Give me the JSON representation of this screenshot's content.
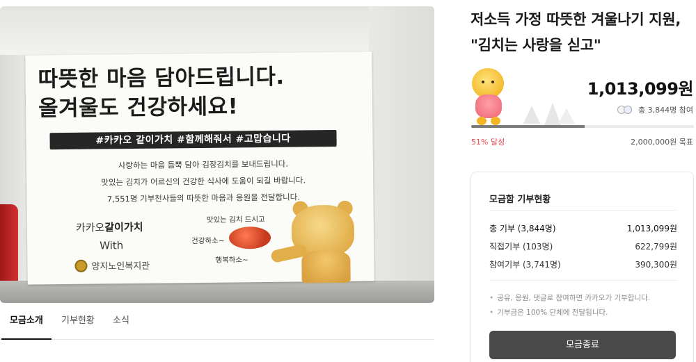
{
  "photo": {
    "sign_title": "따뜻한 마음 담아드립니다.\n올겨울도 건강하세요!",
    "sign_tags": "#카카오 같이가치  #함께해줘서  #고맙습니다",
    "sign_lines": [
      "사랑하는 마음 듬뿍 담아 김장김치를 보내드립니다.",
      "맛있는 김치가 어르신의 건강한 식사에 도움이 되길 바랍니다.",
      "7,551명 기부천사들의 따뜻한 마음과 응원을 전달합니다."
    ],
    "brand_prefix": "카카오",
    "brand_bold": "같이가치",
    "with": "With",
    "org": "양지노인복지관",
    "bubble_1": "맛있는 김치 드시고",
    "bubble_2": "건강하소~",
    "bubble_3": "행복하소~"
  },
  "tabs": [
    {
      "label": "모금소개",
      "active": true
    },
    {
      "label": "기부현황",
      "active": false
    },
    {
      "label": "소식",
      "active": false
    }
  ],
  "campaign": {
    "title": "저소득 가정 따뜻한 겨울나기 지원, \"김치는 사랑을 싣고\"",
    "raised": "1,013,099원",
    "participants": "총 3,844명 참여",
    "progress_percent": 51,
    "achieved": "51% 달성",
    "goal": "2,000,000원 목표"
  },
  "donation_status": {
    "title": "모금함 기부현황",
    "rows": [
      {
        "label": "총 기부 (3,844명)",
        "value": "1,013,099원"
      },
      {
        "label": "직접기부 (103명)",
        "value": "622,799원"
      },
      {
        "label": "참여기부 (3,741명)",
        "value": "390,300원"
      }
    ],
    "notes": [
      "공유, 응원, 댓글로 참여하면 카카오가 기부합니다.",
      "기부금은 100% 단체에 전달됩니다."
    ],
    "button_label": "모금종료"
  },
  "colors": {
    "accent_red": "#e8484e",
    "button_dark": "#4a4a4a",
    "progress_fill": "#7a7a7a"
  }
}
